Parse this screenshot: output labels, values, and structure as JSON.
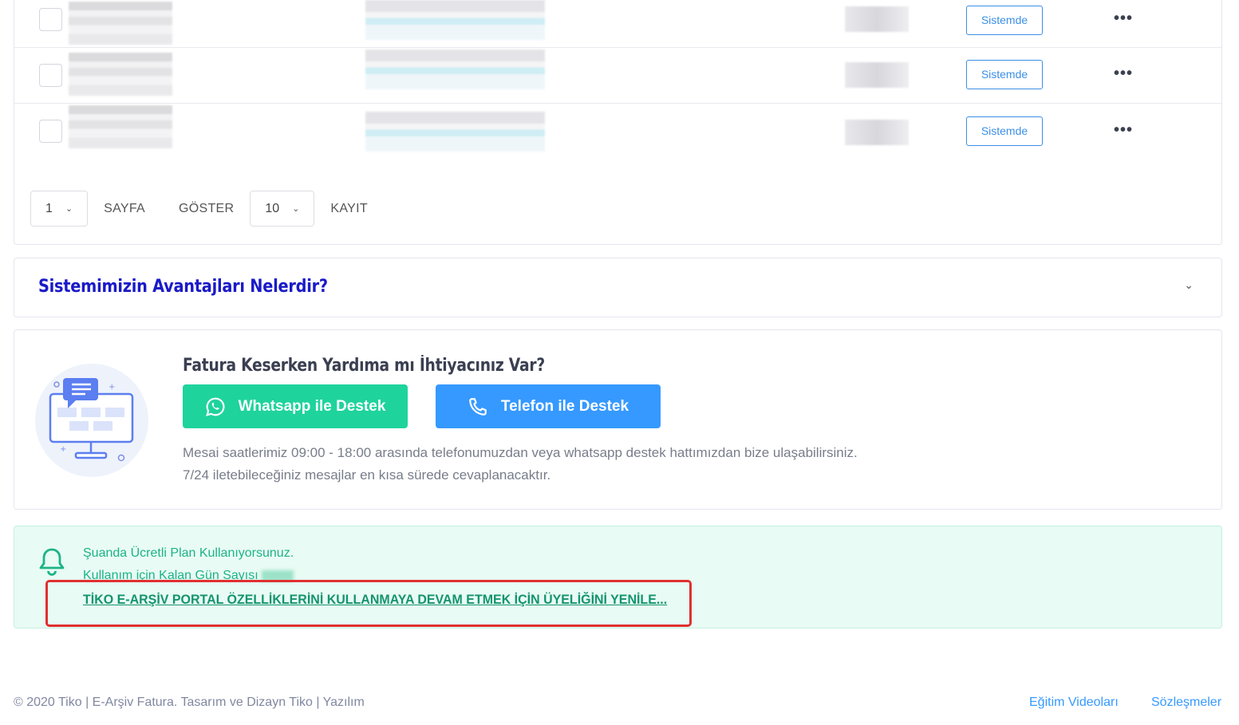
{
  "table": {
    "rows": [
      {
        "status": "Sistemde",
        "more": "•••"
      },
      {
        "status": "Sistemde",
        "more": "•••"
      },
      {
        "status": "Sistemde",
        "more": "•••"
      }
    ],
    "pager": {
      "page_value": "1",
      "page_label": "SAYFA",
      "show_label": "GÖSTER",
      "count_value": "10",
      "records_label": "KAYIT"
    }
  },
  "accordion": {
    "title": "Sistemimizin Avantajları Nelerdir?"
  },
  "help": {
    "title": "Fatura Keserken Yardıma mı İhtiyacınız Var?",
    "whatsapp_label": "Whatsapp ile Destek",
    "phone_label": "Telefon ile Destek",
    "text_line1": "Mesai saatlerimiz 09:00 - 18:00 arasında telefonumuzdan veya whatsapp destek hattımızdan bize ulaşabilirsiniz.",
    "text_line2": "7/24 iletebileceğiniz mesajlar en kısa sürede cevaplanacaktır.",
    "colors": {
      "whatsapp": "#1fd39c",
      "phone": "#3699ff"
    }
  },
  "notice": {
    "line1": "Şuanda Ücretli Plan Kullanıyorsunuz.",
    "line2": "Kullanım için Kalan Gün Sayısı",
    "renew_link": "TİKO E-ARŞİV PORTAL ÖZELLİKLERİNİ KULLANMAYA DEVAM ETMEK İÇİN ÜYELİĞİNİ YENİLE..."
  },
  "footer": {
    "copyright": "© 2020 Tiko | E-Arşiv Fatura. Tasarım ve Dizayn Tiko | Yazılım",
    "links": [
      "Eğitim Videoları",
      "Sözleşmeler"
    ]
  }
}
